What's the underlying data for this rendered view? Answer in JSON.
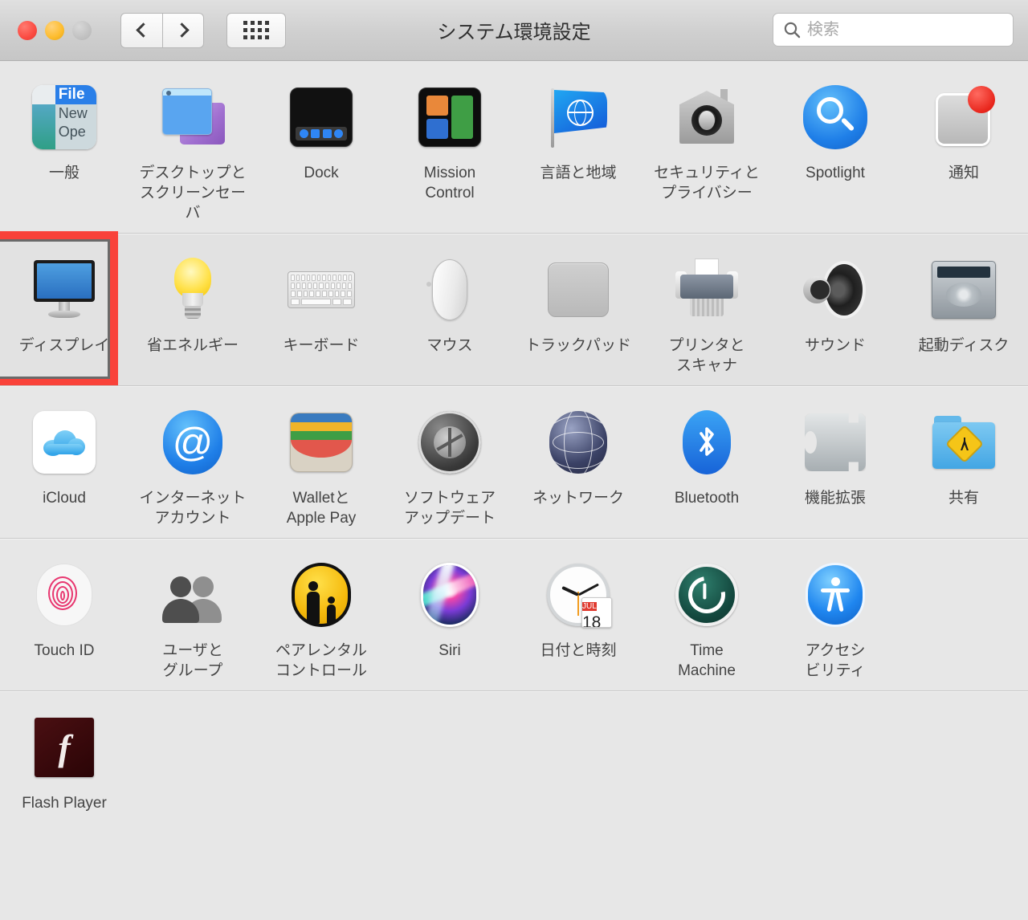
{
  "window": {
    "title": "システム環境設定",
    "traffic_lights": [
      "close",
      "minimize",
      "zoom"
    ],
    "nav": {
      "back": "back",
      "forward": "forward",
      "show_all": "show-all-grid"
    },
    "search": {
      "placeholder": "検索",
      "value": ""
    }
  },
  "highlight": {
    "target": "ディスプレイ",
    "color": "#f9423a"
  },
  "sections": [
    {
      "id": "personal",
      "shaded": false,
      "items": [
        {
          "label": "一般",
          "icon": "general-icon"
        },
        {
          "label": "デスクトップと\nスクリーンセーバ",
          "icon": "desktop-screensaver-icon"
        },
        {
          "label": "Dock",
          "icon": "dock-icon"
        },
        {
          "label": "Mission\nControl",
          "icon": "mission-control-icon"
        },
        {
          "label": "言語と地域",
          "icon": "language-region-icon"
        },
        {
          "label": "セキュリティと\nプライバシー",
          "icon": "security-privacy-icon"
        },
        {
          "label": "Spotlight",
          "icon": "spotlight-icon"
        },
        {
          "label": "通知",
          "icon": "notifications-icon"
        }
      ]
    },
    {
      "id": "hardware",
      "shaded": true,
      "items": [
        {
          "label": "ディスプレイ",
          "icon": "displays-icon",
          "highlighted": true
        },
        {
          "label": "省エネルギー",
          "icon": "energy-saver-icon"
        },
        {
          "label": "キーボード",
          "icon": "keyboard-icon"
        },
        {
          "label": "マウス",
          "icon": "mouse-icon"
        },
        {
          "label": "トラックパッド",
          "icon": "trackpad-icon"
        },
        {
          "label": "プリンタと\nスキャナ",
          "icon": "printers-scanners-icon"
        },
        {
          "label": "サウンド",
          "icon": "sound-icon"
        },
        {
          "label": "起動ディスク",
          "icon": "startup-disk-icon"
        }
      ]
    },
    {
      "id": "internet",
      "shaded": false,
      "items": [
        {
          "label": "iCloud",
          "icon": "icloud-icon"
        },
        {
          "label": "インターネット\nアカウント",
          "icon": "internet-accounts-icon"
        },
        {
          "label": "Walletと\nApple Pay",
          "icon": "wallet-apple-pay-icon"
        },
        {
          "label": "ソフトウェア\nアップデート",
          "icon": "software-update-icon"
        },
        {
          "label": "ネットワーク",
          "icon": "network-icon"
        },
        {
          "label": "Bluetooth",
          "icon": "bluetooth-icon"
        },
        {
          "label": "機能拡張",
          "icon": "extensions-icon"
        },
        {
          "label": "共有",
          "icon": "sharing-icon"
        }
      ]
    },
    {
      "id": "system",
      "shaded": false,
      "items": [
        {
          "label": "Touch ID",
          "icon": "touch-id-icon"
        },
        {
          "label": "ユーザと\nグループ",
          "icon": "users-groups-icon"
        },
        {
          "label": "ペアレンタル\nコントロール",
          "icon": "parental-controls-icon"
        },
        {
          "label": "Siri",
          "icon": "siri-icon"
        },
        {
          "label": "日付と時刻",
          "icon": "date-time-icon",
          "calendar_month": "JUL",
          "calendar_day": "18"
        },
        {
          "label": "Time\nMachine",
          "icon": "time-machine-icon"
        },
        {
          "label": "アクセシ\nビリティ",
          "icon": "accessibility-icon"
        }
      ]
    },
    {
      "id": "other",
      "shaded": false,
      "items": [
        {
          "label": "Flash Player",
          "icon": "flash-player-icon",
          "glyph": "f"
        }
      ]
    }
  ]
}
